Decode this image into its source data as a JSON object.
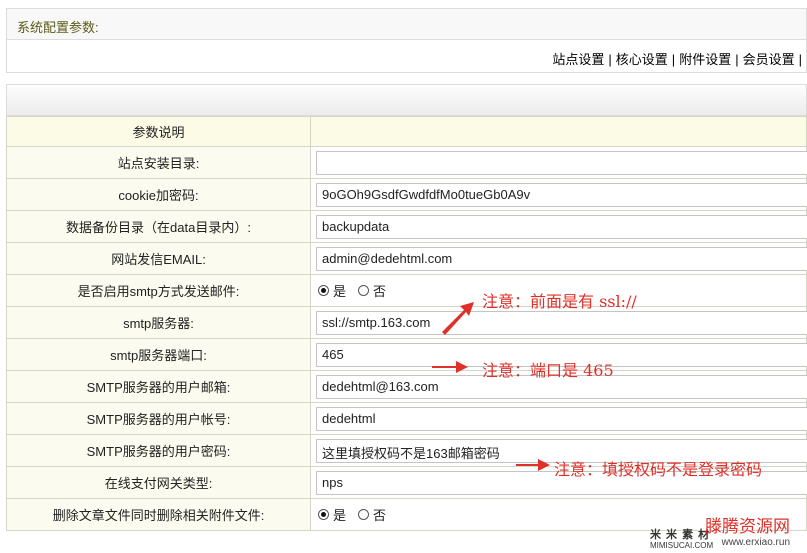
{
  "panel": {
    "title": "系统配置参数:"
  },
  "nav": [
    {
      "label": "站点设置"
    },
    {
      "label": "核心设置"
    },
    {
      "label": "附件设置"
    },
    {
      "label": "会员设置"
    }
  ],
  "table": {
    "header_label": "参数说明",
    "rows": [
      {
        "label": "站点安装目录:",
        "type": "text",
        "value": ""
      },
      {
        "label": "cookie加密码:",
        "type": "text",
        "value": "9oGOh9GsdfGwdfdfMo0tueGb0A9v"
      },
      {
        "label": "数据备份目录（在data目录内）:",
        "type": "text",
        "value": "backupdata"
      },
      {
        "label": "网站发信EMAIL:",
        "type": "text",
        "value": "admin@dedehtml.com"
      },
      {
        "label": "是否启用smtp方式发送邮件:",
        "type": "radio",
        "options": [
          "是",
          "否"
        ],
        "selected": "是"
      },
      {
        "label": "smtp服务器:",
        "type": "text",
        "value": "ssl://smtp.163.com"
      },
      {
        "label": "smtp服务器端口:",
        "type": "text",
        "value": "465"
      },
      {
        "label": "SMTP服务器的用户邮箱:",
        "type": "text",
        "value": "dedehtml@163.com"
      },
      {
        "label": "SMTP服务器的用户帐号:",
        "type": "text",
        "value": "dedehtml"
      },
      {
        "label": "SMTP服务器的用户密码:",
        "type": "text",
        "value": "这里填授权码不是163邮箱密码"
      },
      {
        "label": "在线支付网关类型:",
        "type": "text",
        "value": "nps"
      },
      {
        "label": "删除文章文件同时删除相关附件文件:",
        "type": "radio",
        "options": [
          "是",
          "否"
        ],
        "selected": "是"
      }
    ]
  },
  "annotations": {
    "note_ssl": "注意：前面是有 ssl://",
    "note_port": "注意：端口是 465",
    "note_pwd": "注意：填授权码不是登录密码",
    "color": "#e0302a"
  },
  "watermark": {
    "left_big": "米 米 素 材",
    "left_small": "MIMISUCAI.COM",
    "right_big": "滕腾资源网",
    "right_small": "www.erxiao.run"
  }
}
